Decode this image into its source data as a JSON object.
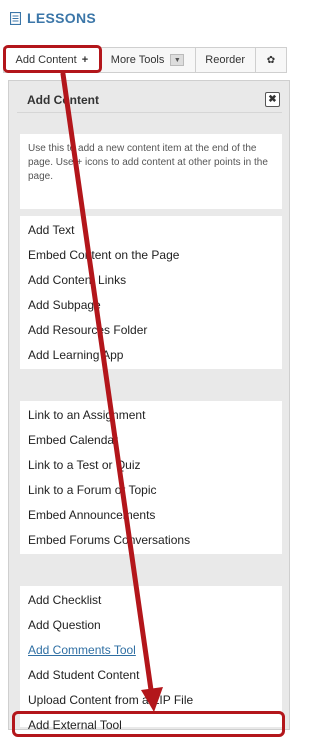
{
  "header": {
    "title": "LESSONS",
    "icon": "document-icon"
  },
  "toolbar": {
    "add_content": "Add Content",
    "add_plus": "+",
    "more_tools": "More Tools",
    "reorder": "Reorder",
    "settings_icon": "gear-icon"
  },
  "dialog": {
    "title": "Add Content",
    "close_icon": "close-icon",
    "description": "Use this to add a new content item at the end of the page. Use + icons to add content at other points in the page.",
    "group1": [
      "Add Text",
      "Embed Content on the Page",
      "Add Content Links",
      "Add Subpage",
      "Add Resources Folder",
      "Add Learning App"
    ],
    "group2": [
      "Link to an Assignment",
      "Embed Calendar",
      "Link to a Test or Quiz",
      "Link to a Forum or Topic",
      "Embed Announcements",
      "Embed Forums Conversations"
    ],
    "group3": [
      "Add Checklist",
      "Add Question",
      "Add Comments Tool",
      "Add Student Content",
      "Upload Content from a ZIP File",
      "Add External Tool"
    ]
  },
  "colors": {
    "highlight": "#b3161b",
    "header_blue": "#3b76a8",
    "link": "#2f6fa3"
  }
}
